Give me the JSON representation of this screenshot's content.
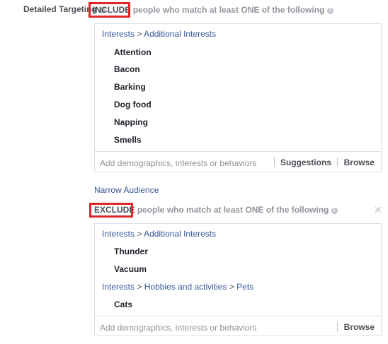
{
  "section": {
    "label": "Detailed Targeting",
    "info_icon": "info-icon"
  },
  "include": {
    "keyword": "INCLUDE",
    "rest": "people who match at least ONE of the following",
    "groups": [
      {
        "breadcrumb": [
          "Interests",
          "Additional Interests"
        ],
        "items": [
          "Attention",
          "Bacon",
          "Barking",
          "Dog food",
          "Napping",
          "Smells"
        ]
      }
    ],
    "input_placeholder": "Add demographics, interests or behaviors",
    "suggestions_label": "Suggestions",
    "browse_label": "Browse"
  },
  "narrow_audience_label": "Narrow Audience",
  "exclude": {
    "keyword": "EXCLUDE",
    "rest": "people who match at least ONE of the following",
    "close_icon": "close-icon",
    "groups": [
      {
        "breadcrumb": [
          "Interests",
          "Additional Interests"
        ],
        "items": [
          "Thunder",
          "Vacuum"
        ]
      },
      {
        "breadcrumb": [
          "Interests",
          "Hobbies and activities",
          "Pets"
        ],
        "items": [
          "Cats"
        ]
      }
    ],
    "input_placeholder": "Add demographics, interests or behaviors",
    "browse_label": "Browse"
  },
  "colors": {
    "highlight_box": "#e0252b",
    "link": "#365899",
    "border": "#dddfe2"
  }
}
